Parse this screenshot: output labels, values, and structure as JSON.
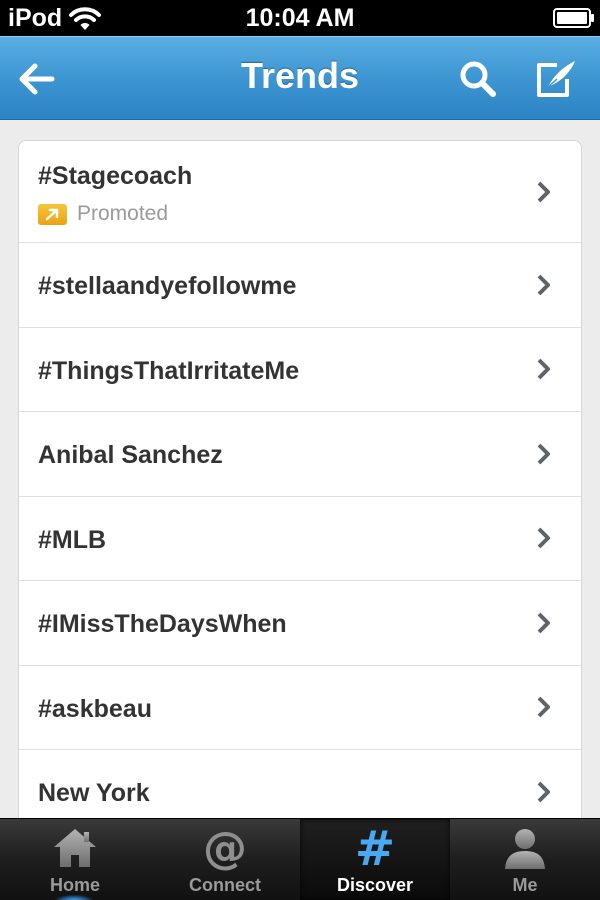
{
  "status_bar": {
    "carrier": "iPod",
    "time": "10:04 AM"
  },
  "nav": {
    "title": "Trends",
    "icons": [
      "back-arrow-icon",
      "search-icon",
      "compose-icon"
    ]
  },
  "trends": [
    {
      "label": "#Stagecoach",
      "promoted_label": "Promoted"
    },
    {
      "label": "#stellaandyefollowme"
    },
    {
      "label": "#ThingsThatIrritateMe"
    },
    {
      "label": "Anibal Sanchez"
    },
    {
      "label": "#MLB"
    },
    {
      "label": "#IMissTheDaysWhen"
    },
    {
      "label": "#askbeau"
    },
    {
      "label": "New York"
    }
  ],
  "tabs": [
    {
      "label": "Home",
      "icon": "house-icon"
    },
    {
      "label": "Connect",
      "icon": "at-sign-icon"
    },
    {
      "label": "Discover",
      "icon": "hashtag-icon",
      "active": true
    },
    {
      "label": "Me",
      "icon": "person-icon"
    }
  ],
  "colors": {
    "nav_blue": "#3d96d2",
    "promoted_orange": "#f0b324",
    "active_tab_icon": "#49a8ef"
  }
}
